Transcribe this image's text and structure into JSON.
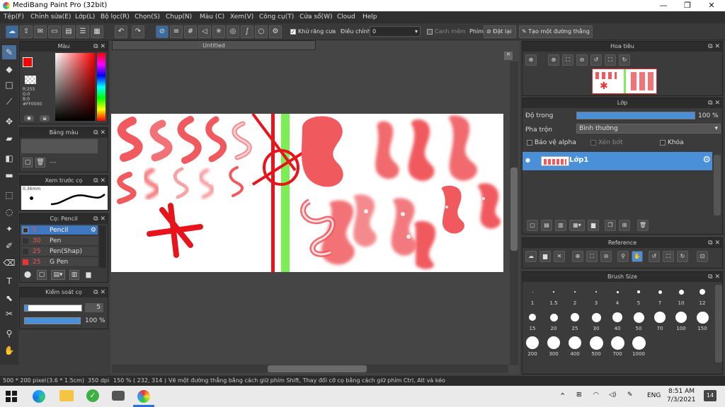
{
  "window": {
    "title": "MediBang Paint Pro (32bit)",
    "minimize": "—",
    "maximize": "❐",
    "close": "✕"
  },
  "menu": [
    "Tệp(F)",
    "Chỉnh sửa(E)",
    "Lớp(L)",
    "Bộ lọc(R)",
    "Chọn(S)",
    "Chụp(N)",
    "Màu (C)",
    "Xem(V)",
    "Công cụ(T)",
    "Cửa sổ(W)",
    "Cloud",
    "Help"
  ],
  "toolbar": {
    "antialias_label": "Khử răng cưa",
    "adjust_label": "Điều chỉnh",
    "adjust_value": "0",
    "soften_label": "Canh mềm",
    "shortcut_label": "Phím",
    "reset_label": "Đặt lại",
    "straight_line_label": "Tạo một đường thẳng"
  },
  "color_panel": {
    "title": "Màu",
    "r": "R:255",
    "g": "G:0",
    "b": "B:0",
    "hex": "#FF0000",
    "foreground": "#ff0000"
  },
  "palette_panel": {
    "title": "Bảng màu",
    "dash": "---"
  },
  "preview_panel": {
    "title": "Xem trước cọ",
    "size": "0.36mm"
  },
  "brush_panel": {
    "title": "Cọ: Pencil",
    "items": [
      {
        "size": "5",
        "name": "Pencil"
      },
      {
        "size": "30",
        "name": "Pen"
      },
      {
        "size": "25",
        "name": "Pen(Shap)"
      },
      {
        "size": "25",
        "name": "G Pen"
      }
    ]
  },
  "brush_control": {
    "title": "Kiểm soát cọ",
    "size_value": "5",
    "opacity_value": "100 %"
  },
  "canvas": {
    "tab": "Untitled"
  },
  "navigator": {
    "title": "Hoa tiêu"
  },
  "layer_panel": {
    "title": "Lớp",
    "opacity_label": "Độ trong",
    "opacity_value": "100 %",
    "opacity_fraction": 1.0,
    "blend_label": "Pha trộn",
    "blend_value": "Bình thường",
    "protect_alpha": "Bảo vệ alpha",
    "clipping": "Xén bớt",
    "lock": "Khóa",
    "layer_name": "Lớp1"
  },
  "reference": {
    "title": "Reference"
  },
  "brush_size": {
    "title": "Brush Size",
    "sizes": [
      "1",
      "1.5",
      "2",
      "3",
      "4",
      "5",
      "7",
      "10",
      "12",
      "15",
      "20",
      "25",
      "30",
      "40",
      "50",
      "70",
      "100",
      "150",
      "200",
      "300",
      "400",
      "500",
      "700",
      "1000"
    ]
  },
  "status": {
    "dims": "500 * 200 pixel",
    "cm": "(3.6 * 1.5cm)",
    "dpi": "350 dpi",
    "zoom": "150 %",
    "coords": "( 232, 314 )",
    "hint": "Vẽ một đường thẳng bằng cách giữ phím Shift, Thay đổi cỡ cọ bằng cách giữ phím Ctrl, Alt và kéo"
  },
  "taskbar": {
    "lang": "ENG",
    "time": "8:51 AM",
    "date": "7/3/2021",
    "notif": "14"
  }
}
